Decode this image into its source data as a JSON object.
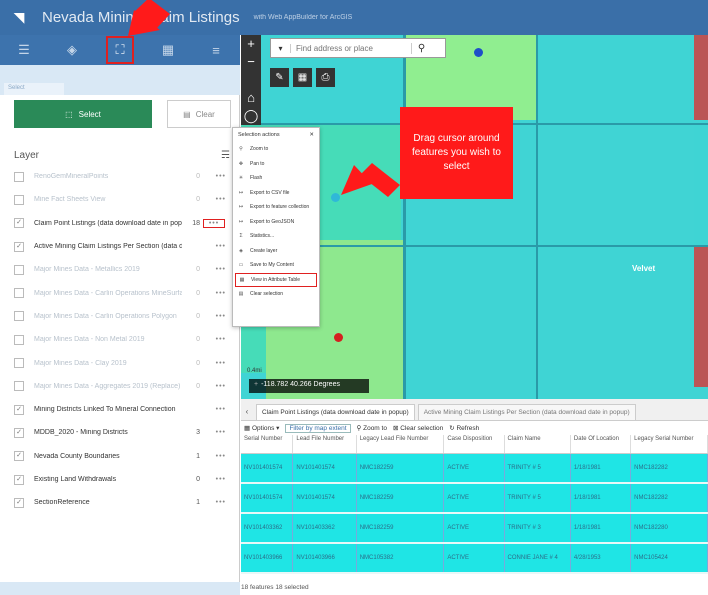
{
  "header": {
    "title": "Nevada Mining Claim Listings",
    "subtitle": "with Web AppBuilder for ArcGIS"
  },
  "toolbar": {
    "icons": [
      "list-icon",
      "layers-icon",
      "select-icon",
      "table-icon",
      "menu-icon"
    ]
  },
  "tab": {
    "label": "Select"
  },
  "select_panel": {
    "select_label": "Select",
    "clear_label": "Clear",
    "layer_heading": "Layer",
    "layers": [
      {
        "name": "RenoGemMineralPoints",
        "count": "0",
        "disabled": true
      },
      {
        "name": "Mine Fact Sheets View",
        "count": "0",
        "disabled": true
      },
      {
        "name": "Claim Point Listings (data download date in popup)",
        "count": "18",
        "disabled": false,
        "checked": true,
        "highlight": true
      },
      {
        "name": "Active Mining Claim Listings Per Section (data download date in popup)",
        "count": "",
        "disabled": false,
        "checked": true
      },
      {
        "name": "Major Mines Data - Metallics 2019",
        "count": "0",
        "disabled": true
      },
      {
        "name": "Major Mines Data - Carlin Operations MineSurface",
        "count": "0",
        "disabled": true
      },
      {
        "name": "Major Mines Data - Carlin Operations Polygon",
        "count": "0",
        "disabled": true
      },
      {
        "name": "Major Mines Data - Non Metal 2019",
        "count": "0",
        "disabled": true
      },
      {
        "name": "Major Mines Data - Clay 2019",
        "count": "0",
        "disabled": true
      },
      {
        "name": "Major Mines Data - Aggregates 2019 (Replace)",
        "count": "0",
        "disabled": true
      },
      {
        "name": "Mining Districts Linked To Mineral Connection",
        "count": "",
        "disabled": false,
        "checked": true
      },
      {
        "name": "MDDB_2020 - Mining Districts",
        "count": "3",
        "disabled": false,
        "checked": true
      },
      {
        "name": "Nevada County Boundaries",
        "count": "1",
        "disabled": false,
        "checked": true
      },
      {
        "name": "Existing Land Withdrawals",
        "count": "0",
        "disabled": false,
        "checked": true
      },
      {
        "name": "SectionReference",
        "count": "1",
        "disabled": false,
        "checked": true
      }
    ]
  },
  "map": {
    "search_placeholder": "Find address or place",
    "place_label": "Velvet",
    "scale_label": "0.4mi",
    "coordinates": "-118.782 40.266 Degrees",
    "callout_text": "Drag cursor around features you wish to select"
  },
  "selection_actions": {
    "title": "Selection actions",
    "items": [
      {
        "icon": "zoom-icon",
        "label": "Zoom to"
      },
      {
        "icon": "pan-icon",
        "label": "Pan to"
      },
      {
        "icon": "flash-icon",
        "label": "Flash"
      },
      {
        "icon": "export-icon",
        "label": "Export to CSV file"
      },
      {
        "icon": "export-icon",
        "label": "Export to feature collection"
      },
      {
        "icon": "export-icon",
        "label": "Export to GeoJSON"
      },
      {
        "icon": "statistics-icon",
        "label": "Statistics..."
      },
      {
        "icon": "layer-icon",
        "label": "Create layer"
      },
      {
        "icon": "save-icon",
        "label": "Save to My Content"
      },
      {
        "icon": "table-icon",
        "label": "View in Attribute Table",
        "highlight": true
      },
      {
        "icon": "clear-icon",
        "label": "Clear selection"
      }
    ]
  },
  "attribute_table": {
    "tabs": [
      "Claim Point Listings (data download date in popup)",
      "Active Mining Claim Listings Per Section (data download date in popup)"
    ],
    "options_label": "Options",
    "filter_label": "Filter by map extent",
    "zoom_label": "Zoom to",
    "clear_label": "Clear selection",
    "refresh_label": "Refresh",
    "columns": [
      "Serial Number",
      "Lead File Number",
      "Legacy Lead File Number",
      "Case Disposition",
      "Claim Name",
      "Date Of Location",
      "Legacy Serial Number"
    ],
    "rows": [
      [
        "NV101401574",
        "NV101401574",
        "NMC182259",
        "ACTIVE",
        "TRINITY # 5",
        "1/18/1981",
        "NMC182282"
      ],
      [
        "NV101401574",
        "NV101401574",
        "NMC182259",
        "ACTIVE",
        "TRINITY # 5",
        "1/18/1981",
        "NMC182282"
      ],
      [
        "NV101403362",
        "NV101403362",
        "NMC182259",
        "ACTIVE",
        "TRINITY # 3",
        "1/18/1981",
        "NMC182280"
      ],
      [
        "NV101403966",
        "NV101403966",
        "NMC105382",
        "ACTIVE",
        "CONNIE JANE # 4",
        "4/28/1953",
        "NMC105424"
      ]
    ],
    "status": "18 features  18 selected"
  }
}
